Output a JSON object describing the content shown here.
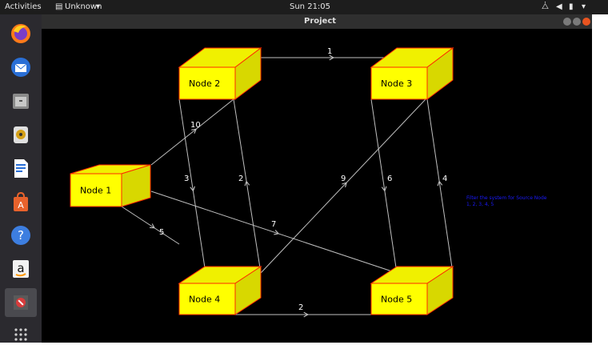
{
  "topbar": {
    "activities": "Activities",
    "app_menu": "Unknown",
    "clock": "Sun 21:05"
  },
  "window": {
    "title": "Project"
  },
  "dock": {
    "items": [
      "firefox-icon",
      "thunderbird-icon",
      "files-icon",
      "rhythmbox-icon",
      "writer-icon",
      "software-center-icon",
      "help-icon",
      "amazon-icon",
      "java-app-icon",
      "show-apps-icon"
    ]
  },
  "graph": {
    "nodes": [
      {
        "id": "node1",
        "label": "Node 1"
      },
      {
        "id": "node2",
        "label": "Node 2"
      },
      {
        "id": "node3",
        "label": "Node 3"
      },
      {
        "id": "node4",
        "label": "Node 4"
      },
      {
        "id": "node5",
        "label": "Node 5"
      }
    ],
    "edges": [
      {
        "from": "Node 2",
        "to": "Node 3",
        "weight": "1"
      },
      {
        "from": "Node 1",
        "to": "Node 2",
        "weight": "10"
      },
      {
        "from": "Node 2",
        "to": "Node 4",
        "weight": "3"
      },
      {
        "from": "Node 4",
        "to": "Node 2",
        "weight": "2"
      },
      {
        "from": "Node 4",
        "to": "Node 3",
        "weight": "9"
      },
      {
        "from": "Node 3",
        "to": "Node 5",
        "weight": "6"
      },
      {
        "from": "Node 5",
        "to": "Node 3",
        "weight": "4"
      },
      {
        "from": "Node 1",
        "to": "Node 5",
        "weight": "7"
      },
      {
        "from": "Node 1",
        "to": "Node 4",
        "weight": "5"
      },
      {
        "from": "Node 4",
        "to": "Node 5",
        "weight": "2"
      }
    ],
    "colors": {
      "node_face": "#ffff00",
      "node_top": "#f0f000",
      "node_side": "#d8d800",
      "node_border": "#ff2a00",
      "edge": "#bfbfbf",
      "info_text": "#1a1aff"
    },
    "info_lines": [
      "Filter the system for Source Node",
      "1, 2, 3, 4, 5"
    ]
  }
}
